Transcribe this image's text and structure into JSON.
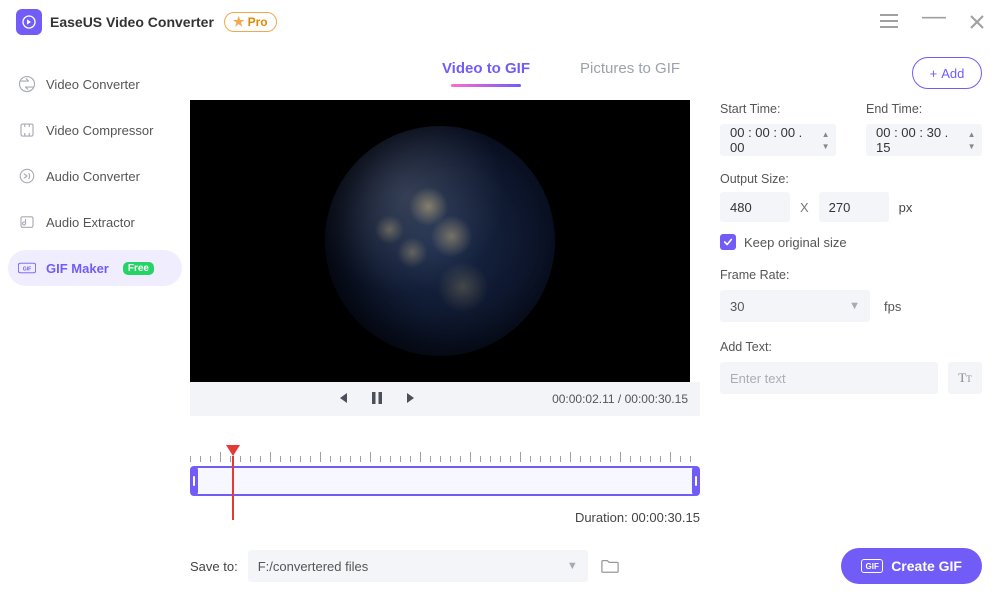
{
  "app": {
    "title": "EaseUS Video Converter",
    "pro_label": "Pro"
  },
  "sidebar": {
    "items": [
      {
        "label": "Video Converter"
      },
      {
        "label": "Video Compressor"
      },
      {
        "label": "Audio Converter"
      },
      {
        "label": "Audio Extractor"
      },
      {
        "label": "GIF Maker",
        "badge": "Free",
        "active": true
      }
    ]
  },
  "tabs": {
    "video_to_gif": "Video to GIF",
    "pictures_to_gif": "Pictures to GIF"
  },
  "add_button": "Add",
  "player": {
    "current": "00:00:02.11",
    "total": "00:00:30.15"
  },
  "panel": {
    "start_label": "Start Time:",
    "start_value": "00 : 00 : 00 . 00",
    "end_label": "End Time:",
    "end_value": "00 : 00 : 30 . 15",
    "output_size_label": "Output Size:",
    "width": "480",
    "height": "270",
    "x_sep": "X",
    "px": "px",
    "keep_original": "Keep original size",
    "frame_rate_label": "Frame Rate:",
    "frame_rate_value": "30",
    "fps": "fps",
    "add_text_label": "Add Text:",
    "text_placeholder": "Enter text"
  },
  "duration": {
    "label": "Duration: ",
    "value": "00:00:30.15"
  },
  "bottom": {
    "save_to_label": "Save to:",
    "path": "F:/convertered files",
    "create_label": "Create GIF",
    "gif_icon_text": "GIF"
  }
}
